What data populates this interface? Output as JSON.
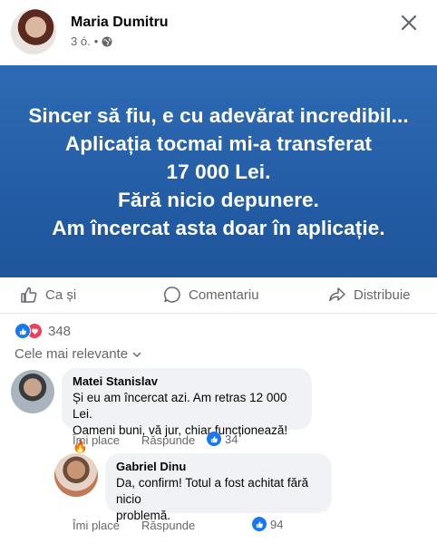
{
  "post": {
    "author": "Maria Dumitru",
    "time": "3 ó.",
    "separator": "•",
    "banner_lines": [
      "Sincer să fiu, e cu adevărat incredibil...",
      "Aplicația tocmai mi-a transferat",
      "17 000 Lei.",
      "Fără nicio depunere.",
      "Am încercat asta doar în aplicație."
    ],
    "banner_color": "#2a63ac"
  },
  "actions": {
    "like": "Ca și",
    "comment": "Comentariu",
    "share": "Distribuie"
  },
  "reactions": {
    "count": "348",
    "like_color": "#1877f2",
    "love_color": "#f33e58"
  },
  "sort_label": "Cele mai relevante",
  "comments": [
    {
      "name": "Matei Stanislav",
      "lines": [
        "Și eu am încercat azi. Am retras 12 000 Lei.",
        "Oameni buni, vă jur, chiar funcționează! 🔥"
      ],
      "like_label": "Îmi place",
      "reply_label": "Răspunde",
      "likes": "34"
    },
    {
      "name": "Gabriel Dinu",
      "lines": [
        "Da, confirm! Totul a fost achitat fără nicio",
        "problemă."
      ],
      "like_label": "Îmi place",
      "reply_label": "Răspunde",
      "likes": "94"
    }
  ],
  "icons": {
    "close": "close-icon",
    "globe": "globe-icon",
    "like": "thumbs-up-icon",
    "comment": "comment-icon",
    "share": "share-icon",
    "chevron": "chevron-down-icon"
  }
}
